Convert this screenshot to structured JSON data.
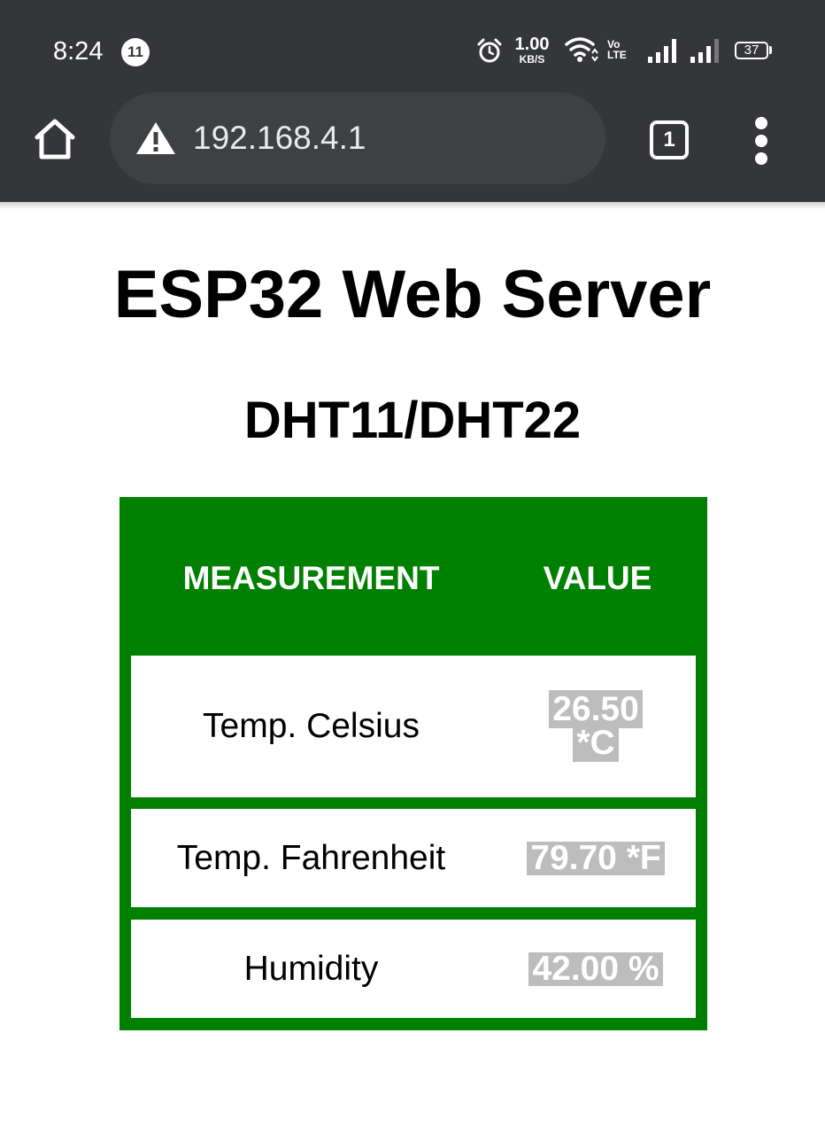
{
  "status_bar": {
    "time": "8:24",
    "notification_count": "11",
    "net_speed_value": "1.00",
    "net_speed_unit": "KB/S",
    "volte_line1": "Vo",
    "volte_line2": "LTE",
    "battery_level": "37"
  },
  "toolbar": {
    "url": "192.168.4.1",
    "tab_count": "1"
  },
  "page": {
    "title": "ESP32 Web Server",
    "subtitle": "DHT11/DHT22"
  },
  "table": {
    "headers": [
      "MEASUREMENT",
      "VALUE"
    ],
    "rows": [
      {
        "label": "Temp. Celsius",
        "value": "26.50 *C"
      },
      {
        "label": "Temp. Fahrenheit",
        "value": "79.70 *F"
      },
      {
        "label": "Humidity",
        "value": "42.00 %"
      }
    ]
  },
  "colors": {
    "chrome_bar": "#35363a",
    "table_green": "#008000",
    "value_highlight": "#bdbdbd"
  }
}
